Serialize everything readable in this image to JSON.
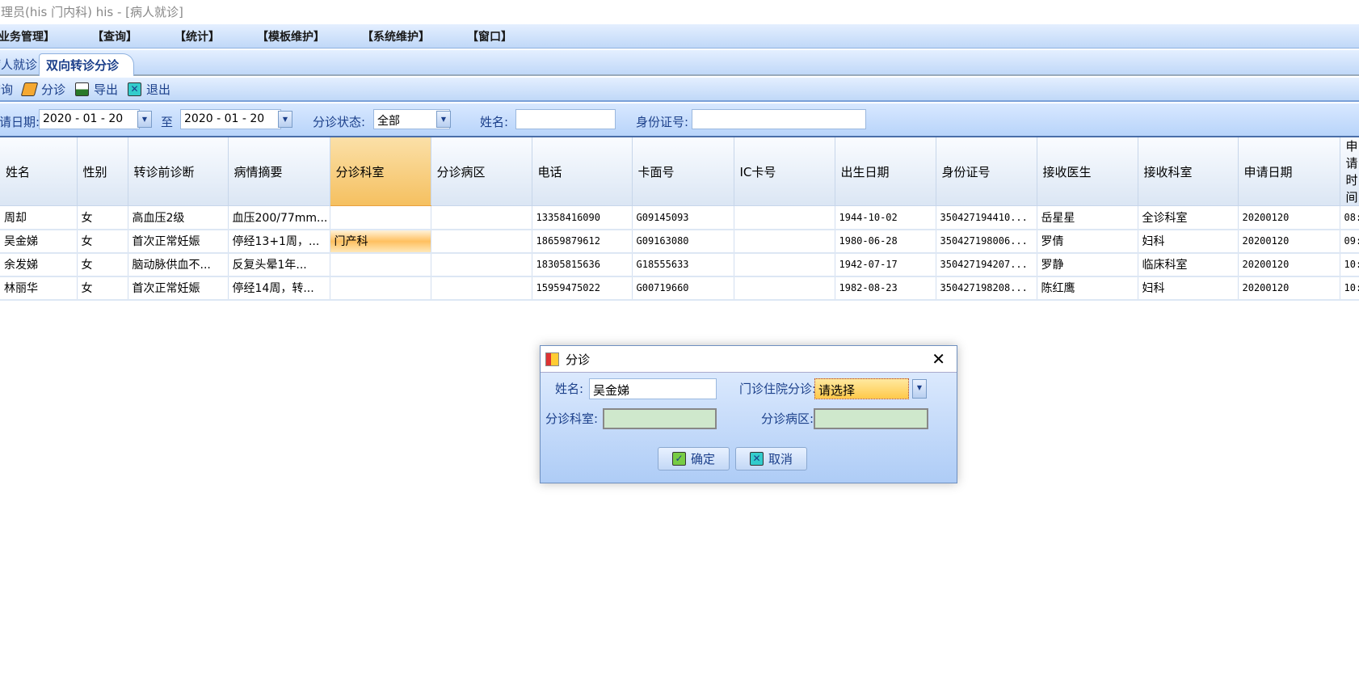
{
  "window": {
    "title": "管理员(his 门内科) his - [病人就诊]"
  },
  "menu": [
    "【业务管理】",
    "【查询】",
    "【统计】",
    "【模板维护】",
    "【系统维护】",
    "【窗口】"
  ],
  "tabs": [
    {
      "label": "病人就诊"
    },
    {
      "label": "双向转诊分诊",
      "active": true
    }
  ],
  "toolbar": {
    "query": "查询",
    "triage": "分诊",
    "export": "导出",
    "exit": "退出"
  },
  "filter": {
    "date_label": "申请日期:",
    "date_from": "2020 - 01 - 20",
    "to_label": "至",
    "date_to": "2020 - 01 - 20",
    "status_label": "分诊状态:",
    "status_value": "全部",
    "name_label": "姓名:",
    "name_value": "",
    "id_label": "身份证号:",
    "id_value": ""
  },
  "table": {
    "columns": [
      "姓名",
      "性别",
      "转诊前诊断",
      "病情摘要",
      "分诊科室",
      "分诊病区",
      "电话",
      "卡面号",
      "IC卡号",
      "出生日期",
      "身份证号",
      "接收医生",
      "接收科室",
      "申请日期",
      "申请时间"
    ],
    "rows": [
      [
        "周却",
        "女",
        "高血压2级",
        "血压200/77mm...",
        "",
        "",
        "13358416090",
        "G09145093",
        "",
        "1944-10-02",
        "350427194410...",
        "岳星星",
        "全诊科室",
        "20200120",
        "08:"
      ],
      [
        "吴金娣",
        "女",
        "首次正常妊娠",
        "停经13+1周，...",
        "门产科",
        "",
        "18659879612",
        "G09163080",
        "",
        "1980-06-28",
        "350427198006...",
        "罗倩",
        "妇科",
        "20200120",
        "09:"
      ],
      [
        "余发娣",
        "女",
        "脑动脉供血不...",
        "反复头晕1年...",
        "",
        "",
        "18305815636",
        "G18555633",
        "",
        "1942-07-17",
        "350427194207...",
        "罗静",
        "临床科室",
        "20200120",
        "10:"
      ],
      [
        "林丽华",
        "女",
        "首次正常妊娠",
        "停经14周，转...",
        "",
        "",
        "15959475022",
        "G00719660",
        "",
        "1982-08-23",
        "350427198208...",
        "陈红鹰",
        "妇科",
        "20200120",
        "10:"
      ]
    ]
  },
  "dialog": {
    "title": "分诊",
    "name_label": "姓名:",
    "name_value": "吴金娣",
    "type_label": "门诊住院分诊:",
    "type_value": "请选择",
    "dept_label": "分诊科室:",
    "dept_value": "",
    "ward_label": "分诊病区:",
    "ward_value": "",
    "ok": "确定",
    "cancel": "取消"
  },
  "colors": {
    "accent": "#1b3f8a",
    "selected": "#f5c060",
    "toolbar": "#c0d8f8"
  }
}
